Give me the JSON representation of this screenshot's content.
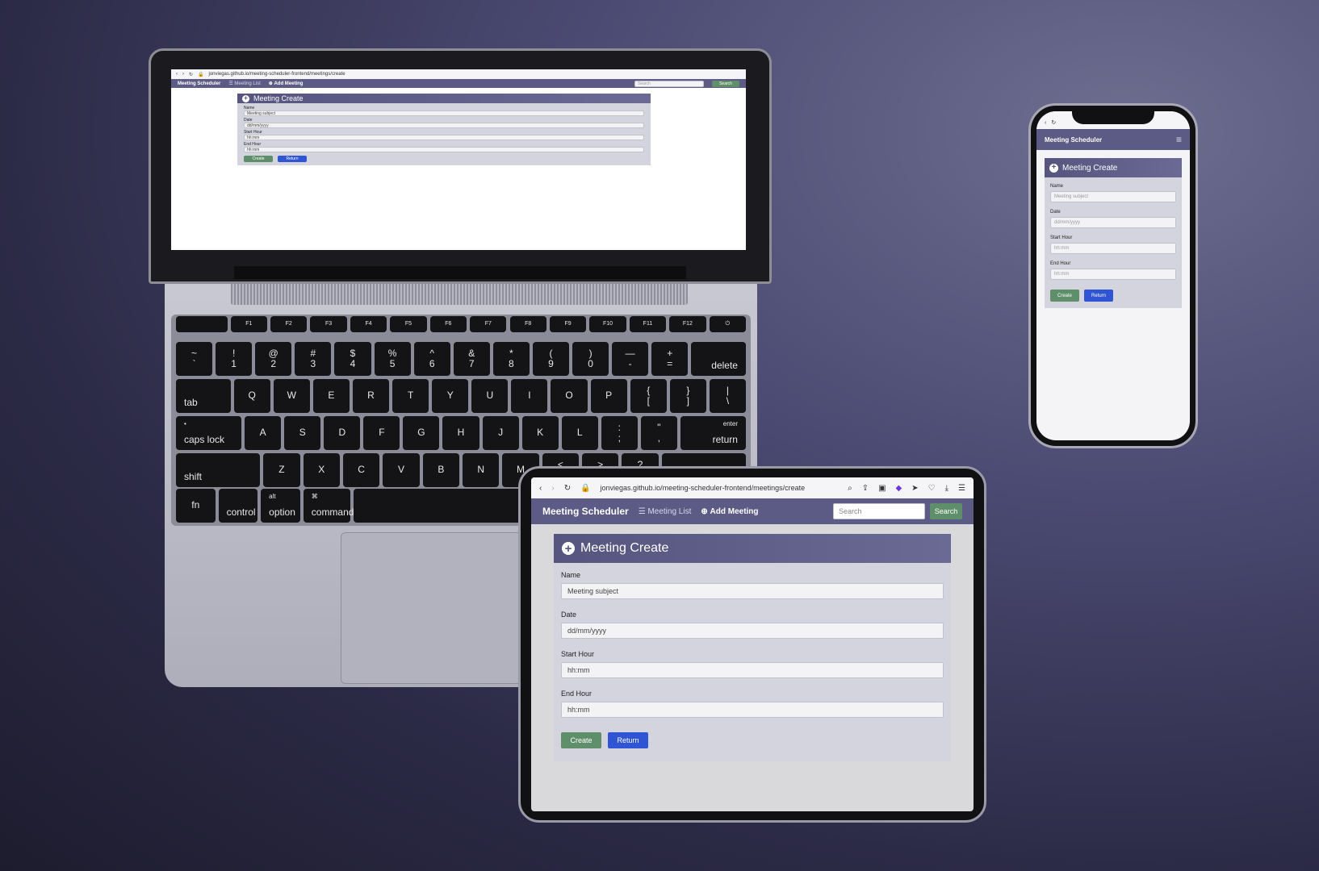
{
  "browser": {
    "url": "jonviegas.github.io/meeting-scheduler-frontend/meetings/create"
  },
  "app": {
    "brand": "Meeting Scheduler",
    "nav": {
      "list": "Meeting List",
      "add": "Add Meeting"
    },
    "search": {
      "placeholder": "Search",
      "button": "Search"
    }
  },
  "form": {
    "title": "Meeting Create",
    "name_label": "Name",
    "name_placeholder": "Meeting subject",
    "date_label": "Date",
    "date_placeholder": "dd/mm/yyyy",
    "start_label": "Start Hour",
    "start_placeholder": "hh:mm",
    "end_label": "End Hour",
    "end_placeholder": "hh:mm",
    "create": "Create",
    "return": "Return"
  },
  "keyboard": {
    "rows": [
      [
        [
          "",
          ""
        ],
        [
          "",
          "F1"
        ],
        [
          "",
          "F2"
        ],
        [
          "",
          "F3"
        ],
        [
          "",
          "F4"
        ],
        [
          "",
          "F5"
        ],
        [
          "",
          "F6"
        ],
        [
          "",
          "F7"
        ],
        [
          "",
          "F8"
        ],
        [
          "",
          "F9"
        ],
        [
          "",
          "F10"
        ],
        [
          "",
          "F11"
        ],
        [
          "",
          "F12"
        ],
        [
          "⏻",
          ""
        ]
      ],
      [
        [
          "~",
          "`"
        ],
        [
          "!",
          "1"
        ],
        [
          "@",
          "2"
        ],
        [
          "#",
          "3"
        ],
        [
          "$",
          "4"
        ],
        [
          "%",
          "5"
        ],
        [
          "^",
          "6"
        ],
        [
          "&",
          "7"
        ],
        [
          "*",
          "8"
        ],
        [
          "(",
          "9"
        ],
        [
          ")",
          "0"
        ],
        [
          "—",
          "-"
        ],
        [
          "+",
          "="
        ],
        [
          "",
          "delete"
        ]
      ],
      [
        [
          "",
          "tab"
        ],
        [
          "Q",
          ""
        ],
        [
          "W",
          ""
        ],
        [
          "E",
          ""
        ],
        [
          "R",
          ""
        ],
        [
          "T",
          ""
        ],
        [
          "Y",
          ""
        ],
        [
          "U",
          ""
        ],
        [
          "I",
          ""
        ],
        [
          "O",
          ""
        ],
        [
          "P",
          ""
        ],
        [
          "{",
          "["
        ],
        [
          "}",
          "]"
        ],
        [
          "|",
          "\\"
        ]
      ],
      [
        [
          "•",
          "caps lock"
        ],
        [
          "A",
          ""
        ],
        [
          "S",
          ""
        ],
        [
          "D",
          ""
        ],
        [
          "F",
          ""
        ],
        [
          "G",
          ""
        ],
        [
          "H",
          ""
        ],
        [
          "J",
          ""
        ],
        [
          "K",
          ""
        ],
        [
          "L",
          ""
        ],
        [
          ":",
          ";"
        ],
        [
          "\"",
          ","
        ],
        [
          "enter",
          "return"
        ]
      ],
      [
        [
          "",
          "shift"
        ],
        [
          "Z",
          ""
        ],
        [
          "X",
          ""
        ],
        [
          "C",
          ""
        ],
        [
          "V",
          ""
        ],
        [
          "B",
          ""
        ],
        [
          "N",
          ""
        ],
        [
          "M",
          ""
        ],
        [
          "<",
          ","
        ],
        [
          ">",
          "."
        ],
        [
          "?",
          "/"
        ],
        [
          "",
          ""
        ]
      ],
      [
        [
          "",
          "fn"
        ],
        [
          "",
          "control"
        ],
        [
          "alt",
          "option"
        ],
        [
          "⌘",
          "command"
        ],
        [
          "",
          ""
        ]
      ]
    ]
  }
}
